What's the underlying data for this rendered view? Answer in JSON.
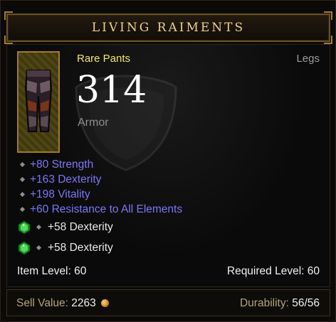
{
  "header": {
    "title": "LIVING RAIMENTS"
  },
  "item": {
    "type": "Rare Pants",
    "slot": "Legs",
    "armor_value": "314",
    "armor_label": "Armor",
    "affixes": [
      "+80 Strength",
      "+163 Dexterity",
      "+198 Vitality",
      "+60 Resistance to All Elements"
    ],
    "socket_bonuses": [
      {
        "icon": "emerald-gem-icon",
        "text": "+58 Dexterity"
      },
      {
        "icon": "emerald-gem-icon",
        "text": "+58 Dexterity"
      }
    ],
    "item_level": "Item Level: 60",
    "required_level": "Required Level: 60"
  },
  "footer": {
    "sell_label": "Sell Value: ",
    "sell_value": "2263",
    "durability_label": "Durability: ",
    "durability_value": "56/56"
  },
  "colors": {
    "title": "#e9d38b",
    "rare": "#f1e86a",
    "magic_affix": "#7b77f7",
    "border_gold": "#a37a2b"
  }
}
